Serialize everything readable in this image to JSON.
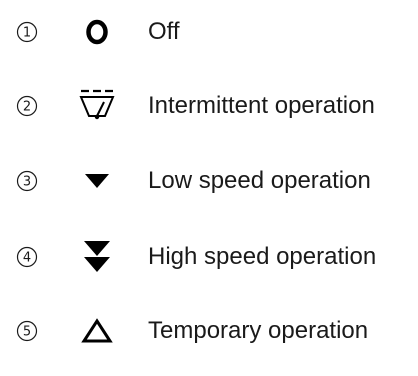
{
  "items": [
    {
      "number": "1",
      "icon": "off-circle-icon",
      "label": "Off"
    },
    {
      "number": "2",
      "icon": "wiper-intermittent-icon",
      "label": "Intermittent operation"
    },
    {
      "number": "3",
      "icon": "single-down-triangle-icon",
      "label": "Low speed operation"
    },
    {
      "number": "4",
      "icon": "double-down-triangle-icon",
      "label": "High speed operation"
    },
    {
      "number": "5",
      "icon": "outline-up-triangle-icon",
      "label": "Temporary operation"
    }
  ],
  "colors": {
    "text": "#1a1a1a",
    "background": "#ffffff"
  }
}
